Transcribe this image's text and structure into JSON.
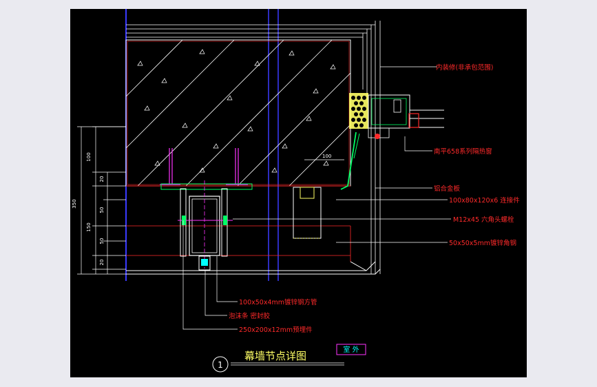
{
  "drawing": {
    "labels": {
      "interior_finish": "内装修(非承包范围)",
      "window": "南平658系列隔热窗",
      "aluminum_panel": "铝合金板",
      "connector": "100x80x120x6 连接件",
      "bolt": "M12x45 六角头螺栓",
      "angle_steel": "50x50x5mm镀锌角钢",
      "square_tube": "100x50x4mm镀锌钢方管",
      "foam_strip": "泡沫条 密封胶",
      "embed_plate": "250x200x12mm预埋件"
    },
    "dimensions": {
      "total": "350",
      "upper": "100",
      "d20a": "20",
      "d50a": "50",
      "middle": "150",
      "d50b": "50",
      "d20b": "20",
      "dim100": "100"
    },
    "title": "幕墙节点详图",
    "detail_number": "1",
    "tag": "室 外"
  },
  "colors": {
    "background": "#000000",
    "frame": "#eaeaf0",
    "label": "#ff2a2a",
    "title": "#ffff66",
    "blue_line": "#3a3aff",
    "magenta": "#ff33ff",
    "green": "#00ff66",
    "cyan": "#00ffff"
  }
}
